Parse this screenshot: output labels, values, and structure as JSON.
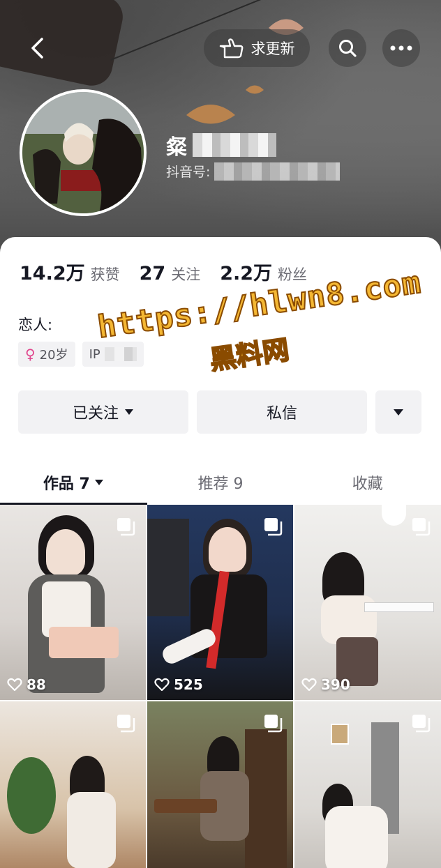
{
  "header": {
    "urge_update_label": "求更新",
    "nickname": "粲",
    "douyin_id_label": "抖音号:"
  },
  "stats": [
    {
      "value": "14.2万",
      "label": "获赞"
    },
    {
      "value": "27",
      "label": "关注"
    },
    {
      "value": "2.2万",
      "label": "粉丝"
    }
  ],
  "bio": "恋人:",
  "tags": [
    {
      "symbol": "♀",
      "text": "20岁"
    },
    {
      "text": "IP"
    }
  ],
  "actions": {
    "follow_label": "已关注",
    "message_label": "私信"
  },
  "tabs": [
    {
      "label": "作品 7",
      "active": true
    },
    {
      "label": "推荐 9"
    },
    {
      "label": "收藏"
    }
  ],
  "watermark": {
    "url": "https://hlwn8.com",
    "text": "黑料网"
  },
  "videos": [
    {
      "likes": "88"
    },
    {
      "likes": "525"
    },
    {
      "likes": "390"
    },
    {
      "likes": ""
    },
    {
      "likes": ""
    },
    {
      "likes": ""
    }
  ],
  "colors": {
    "watermark_fill": "#f4b733",
    "female_tag": "#e0468d"
  }
}
